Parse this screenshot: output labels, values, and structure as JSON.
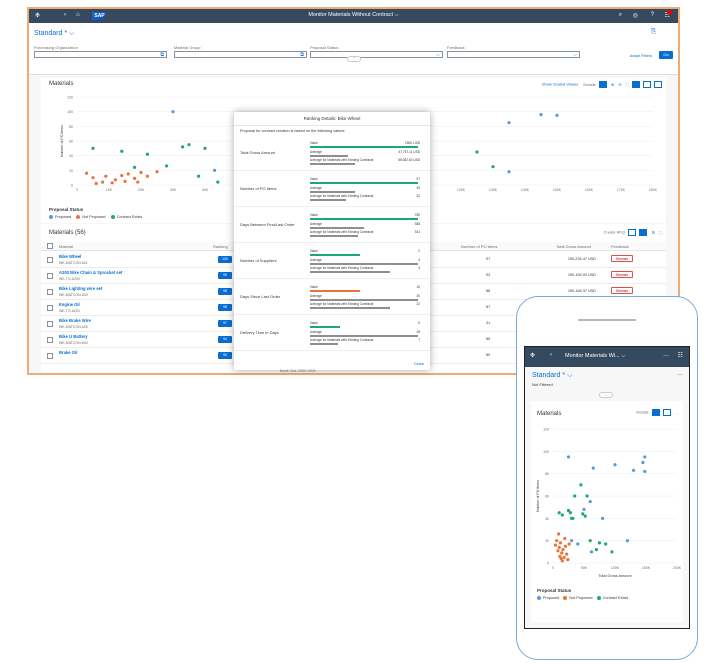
{
  "desktop": {
    "shell": {
      "title": "Monitor Materials Without Contract ⌵",
      "logo": "SAP",
      "icons": [
        "back-icon",
        "home-icon",
        "search-icon",
        "notifications-icon",
        "help-icon",
        "user-icon"
      ]
    },
    "filterbar": {
      "variant": "Standard * ⌵",
      "fields": [
        {
          "label": "Purchasing Organization",
          "value": ""
        },
        {
          "label": "Material Group",
          "value": ""
        },
        {
          "label": "Proposal Status",
          "value": ""
        },
        {
          "label": "Feedback",
          "value": ""
        }
      ],
      "adapt_filters": "Adapt Filters",
      "go": "Go"
    },
    "chart": {
      "title": "Materials",
      "show_scaled": "Show Scaled Values",
      "details": "Details",
      "legend_title": "Proposal Status",
      "legend": [
        "Proposed",
        "Not Proposed",
        "Contract Exists"
      ],
      "y_axis_label": "Number of PO Items",
      "y_ticks": [
        "120",
        "100",
        "80",
        "60",
        "40",
        "20",
        "0"
      ],
      "x_ticks": [
        "0",
        "10K",
        "20K",
        "30K",
        "40K",
        "50K",
        "",
        "",
        "",
        "",
        "",
        "",
        "120K",
        "130K",
        "140K",
        "150K",
        "160K",
        "170K",
        "180K"
      ]
    },
    "table": {
      "title": "Materials (56)",
      "create_rfq": "Create RFQ",
      "headers": {
        "material": "Material",
        "ranking": "Ranking",
        "po_items": "Number of PO Items",
        "gross": "Total Gross Amount",
        "feedback": "Feedback"
      },
      "rows": [
        {
          "name": "Bike Wheel",
          "id": "WE-MATCON-601",
          "rank": "100",
          "po": "97",
          "amount": "150,234.47 USD",
          "dismiss": "Dismiss"
        },
        {
          "name": "A200 Bike Chain & Sprocket set",
          "id": "WE-TG-A200",
          "rank": "99",
          "po": "93",
          "amount": "150,159.00 USD",
          "dismiss": "Dismiss"
        },
        {
          "name": "Bike Lighting wire set",
          "id": "WE-MATCON-603",
          "rank": "98",
          "po": "88",
          "amount": "150,168.37 USD",
          "dismiss": "Dismiss"
        },
        {
          "name": "Engine Oil",
          "id": "WE-TG-A201",
          "rank": "98",
          "po": "87",
          "amount": "",
          "dismiss": ""
        },
        {
          "name": "Bike Brake Wire",
          "id": "WE-MATCON-605",
          "rank": "97",
          "po": "31",
          "amount": "",
          "dismiss": ""
        },
        {
          "name": "Bike U Battery",
          "id": "WE-MATCON-604",
          "rank": "94",
          "po": "85",
          "amount": "",
          "dismiss": ""
        },
        {
          "name": "Brake Oil",
          "id": "",
          "rank": "90",
          "po": "80",
          "amount": "",
          "dismiss": ""
        }
      ]
    },
    "popover": {
      "title": "Ranking Details: Bike Wheel",
      "intro": "Proposal for contract creation is based on the following values:",
      "metrics": [
        {
          "label": "Total Gross Amount",
          "value": "150K USD",
          "average": "47,757.11 USD",
          "avg_contract": "55,082.50 USD"
        },
        {
          "label": "Number of PO Items",
          "value": "97",
          "average": "40",
          "avg_contract": "32"
        },
        {
          "label": "Days Between First/Last Order",
          "value": "780",
          "average": "388",
          "avg_contract": "341"
        },
        {
          "label": "Number of Suppliers",
          "value": "2",
          "average": "4",
          "avg_contract": "3"
        },
        {
          "label": "Days Since Last Order",
          "value": "10",
          "average": "30",
          "avg_contract": "22"
        },
        {
          "label": "Delivery Time in Days",
          "value": "5",
          "average": "28",
          "avg_contract": "7"
        }
      ],
      "row_labels": {
        "value": "Value",
        "average": "Average",
        "avg_contract": "Average for Materials with Existing Contracts"
      },
      "footer_text": "Bank Out: 2000 USD",
      "close": "Close"
    }
  },
  "mobile": {
    "title": "Monitor Materials Wi... ⌵",
    "variant": "Standard * ⌵",
    "not_filtered": "Not Filtered",
    "chart_title": "Materials",
    "details": "Details",
    "y_axis_label": "Number of PO Items",
    "x_axis_label": "Total Gross Amount",
    "y_ticks": [
      "120",
      "100",
      "80",
      "60",
      "40",
      "20",
      "0"
    ],
    "x_ticks": [
      "0",
      "50K",
      "100K",
      "150K",
      "200K"
    ],
    "legend_title": "Proposal Status",
    "legend": [
      "Proposed",
      "Not Proposed",
      "Contract Exists"
    ]
  },
  "colors": {
    "proposed": "#5899da",
    "not_proposed": "#e8743b",
    "contract": "#19a979",
    "brand": "#0a6ed1",
    "shell": "#354a5f"
  },
  "chart_data": [
    {
      "type": "scatter",
      "title": "Materials",
      "xlabel": "",
      "ylabel": "Number of PO Items",
      "xlim": [
        0,
        180000
      ],
      "ylim": [
        0,
        120
      ],
      "series": [
        {
          "name": "Proposed",
          "points": [
            [
              30000,
              100
            ],
            [
              145000,
              96
            ],
            [
              150000,
              95
            ],
            [
              135000,
              85
            ],
            [
              43000,
              20
            ],
            [
              100000,
              30
            ],
            [
              135000,
              18
            ]
          ]
        },
        {
          "name": "Not Proposed",
          "points": [
            [
              3000,
              16
            ],
            [
              5000,
              10
            ],
            [
              9000,
              12
            ],
            [
              12000,
              7
            ],
            [
              14000,
              13
            ],
            [
              16000,
              15
            ],
            [
              18000,
              9
            ],
            [
              20000,
              17
            ],
            [
              22000,
              12
            ],
            [
              25000,
              18
            ],
            [
              8000,
              4
            ],
            [
              11000,
              3
            ],
            [
              15000,
              5
            ],
            [
              6000,
              2
            ],
            [
              19000,
              4
            ]
          ]
        },
        {
          "name": "Contract Exists",
          "points": [
            [
              5000,
              50
            ],
            [
              14000,
              46
            ],
            [
              22000,
              42
            ],
            [
              33000,
              52
            ],
            [
              35000,
              55
            ],
            [
              40000,
              50
            ],
            [
              18000,
              24
            ],
            [
              28000,
              26
            ],
            [
              38000,
              12
            ],
            [
              44000,
              4
            ],
            [
              125000,
              45
            ],
            [
              130000,
              25
            ]
          ]
        }
      ]
    },
    {
      "type": "scatter",
      "title": "Materials",
      "xlabel": "Total Gross Amount",
      "ylabel": "Number of PO Items",
      "xlim": [
        0,
        200000
      ],
      "ylim": [
        0,
        120
      ],
      "series": [
        {
          "name": "Proposed",
          "points": [
            [
              25000,
              95
            ],
            [
              100000,
              88
            ],
            [
              145000,
              90
            ],
            [
              148000,
              95
            ],
            [
              148000,
              82
            ],
            [
              65000,
              85
            ],
            [
              50000,
              48
            ],
            [
              80000,
              40
            ],
            [
              130000,
              83
            ],
            [
              60000,
              55
            ],
            [
              30000,
              20
            ],
            [
              40000,
              17
            ],
            [
              120000,
              20
            ],
            [
              62000,
              10
            ]
          ]
        },
        {
          "name": "Not Proposed",
          "points": [
            [
              4000,
              16
            ],
            [
              6000,
              20
            ],
            [
              8000,
              11
            ],
            [
              10000,
              14
            ],
            [
              12000,
              18
            ],
            [
              14000,
              9
            ],
            [
              16000,
              12
            ],
            [
              18000,
              5
            ],
            [
              20000,
              15
            ],
            [
              22000,
              8
            ],
            [
              24000,
              3
            ],
            [
              26000,
              17
            ],
            [
              9000,
              26
            ],
            [
              11000,
              6
            ],
            [
              15000,
              2
            ],
            [
              19000,
              22
            ],
            [
              13000,
              4
            ]
          ]
        },
        {
          "name": "Contract Exists",
          "points": [
            [
              10000,
              45
            ],
            [
              15000,
              43
            ],
            [
              25000,
              47
            ],
            [
              28000,
              45
            ],
            [
              30000,
              40
            ],
            [
              35000,
              60
            ],
            [
              45000,
              70
            ],
            [
              48000,
              44
            ],
            [
              52000,
              42
            ],
            [
              55000,
              60
            ],
            [
              32000,
              40
            ],
            [
              60000,
              20
            ],
            [
              70000,
              12
            ],
            [
              85000,
              17
            ],
            [
              95000,
              10
            ],
            [
              75000,
              18
            ]
          ]
        }
      ]
    }
  ]
}
